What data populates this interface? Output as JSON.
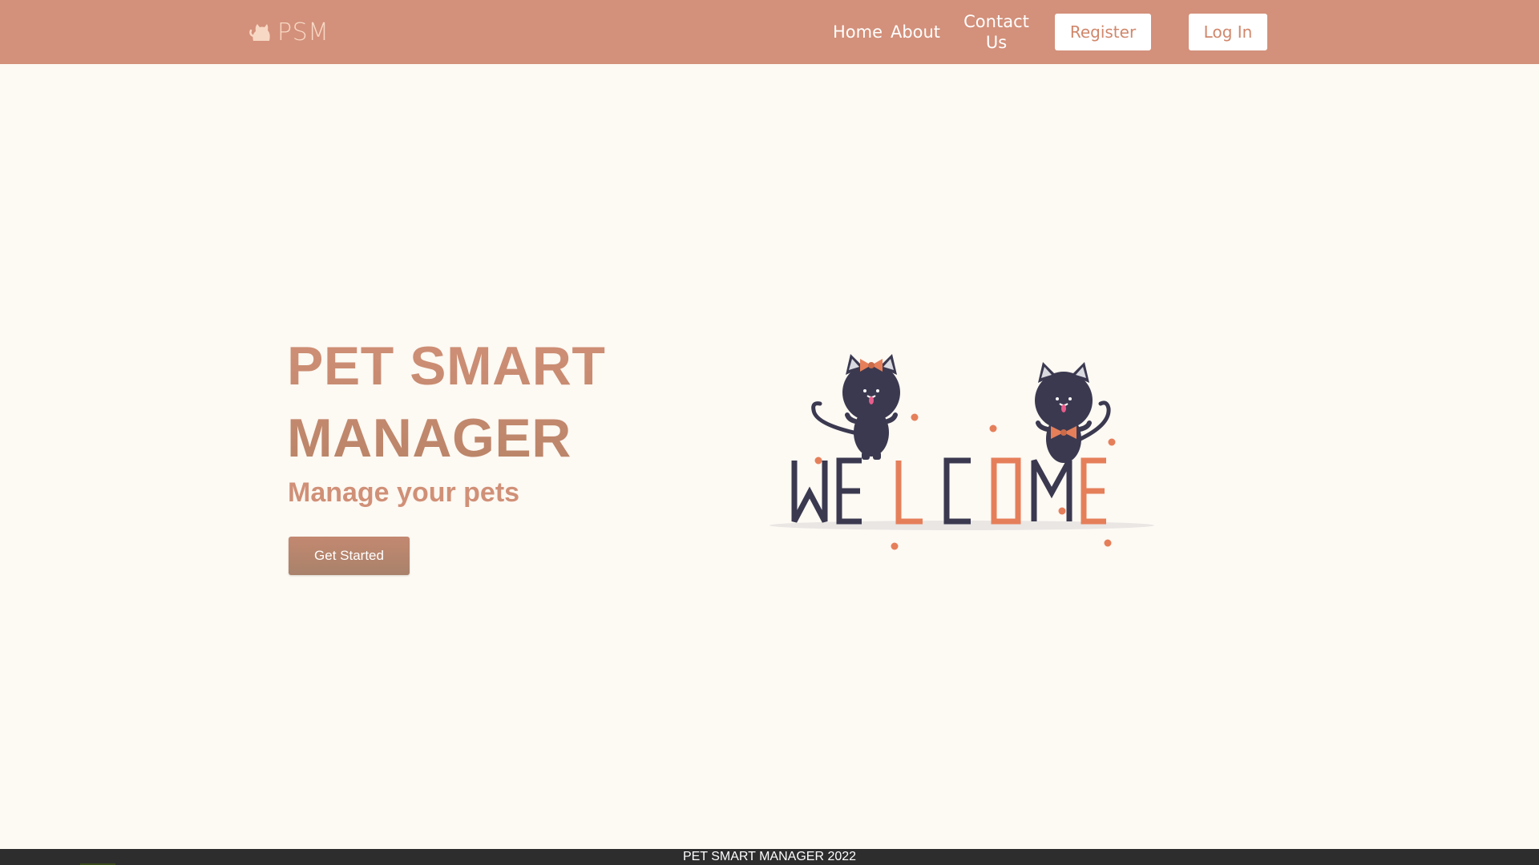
{
  "nav": {
    "brand": "PSM",
    "brand_icon": "cat-icon",
    "links": [
      "Home",
      "About",
      "Contact Us"
    ],
    "register": "Register",
    "login": "Log In"
  },
  "hero": {
    "title_line1": "PET SMART",
    "title_line2": "MANAGER",
    "subtitle": "Manage your pets",
    "cta": "Get Started",
    "illustration_text": "WELCOME"
  },
  "footer": {
    "text": "PET SMART MANAGER 2022"
  },
  "colors": {
    "nav_bg": "#d3907a",
    "page_bg": "#fdf9f3",
    "accent": "#e57f5a",
    "navy": "#3b3950",
    "footer_bg": "#2d2d2d"
  }
}
